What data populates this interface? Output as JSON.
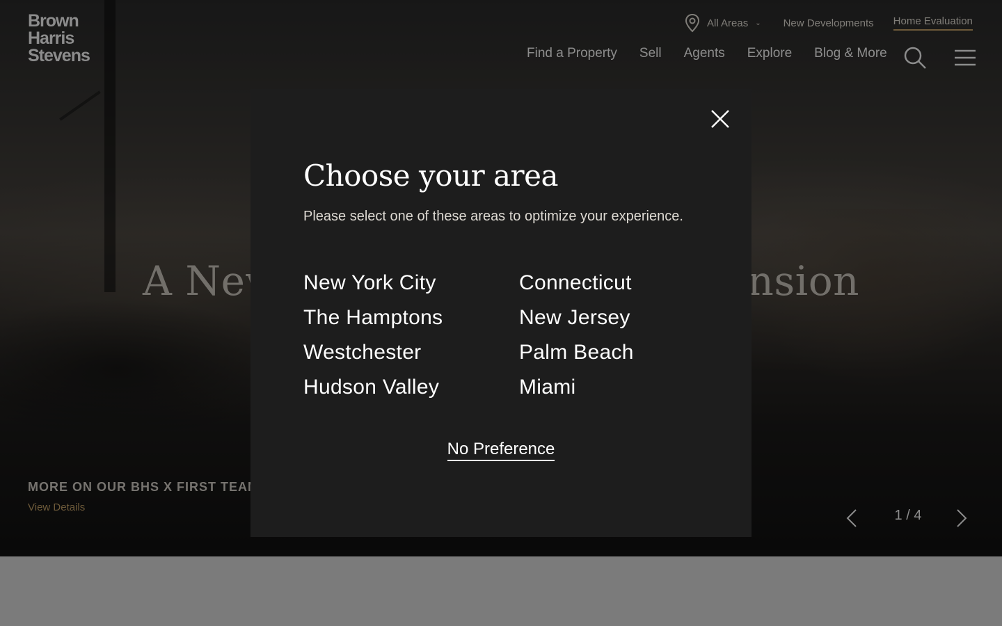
{
  "header": {
    "logo_line1": "Brown",
    "logo_line2": "Harris",
    "logo_line3": "Stevens",
    "area_select_label": "All Areas",
    "utility_links": [
      "New Developments",
      "Home Evaluation"
    ],
    "nav_items": [
      "Find a Property",
      "Sell",
      "Agents",
      "Explore",
      "Blog & More"
    ]
  },
  "hero": {
    "title_left": "A New",
    "title_right": "ansion",
    "caption_title": "MORE ON OUR BHS X FIRST TEAM",
    "caption_link": "View Details",
    "slide_counter": "1 / 4"
  },
  "modal": {
    "title": "Choose your area",
    "subtitle": "Please select one of these areas to optimize your experience.",
    "areas": [
      "New York City",
      "Connecticut",
      "The Hamptons",
      "New Jersey",
      "Westchester",
      "Palm Beach",
      "Hudson Valley",
      "Miami"
    ],
    "no_preference": "No Preference"
  },
  "colors": {
    "accent_gold": "#c8a56a",
    "modal_bg": "#1d1d1d"
  },
  "icons": {
    "location": "location-pin-icon",
    "search": "search-icon",
    "menu": "hamburger-menu-icon",
    "close": "close-icon",
    "prev": "chevron-left-icon",
    "next": "chevron-right-icon"
  }
}
